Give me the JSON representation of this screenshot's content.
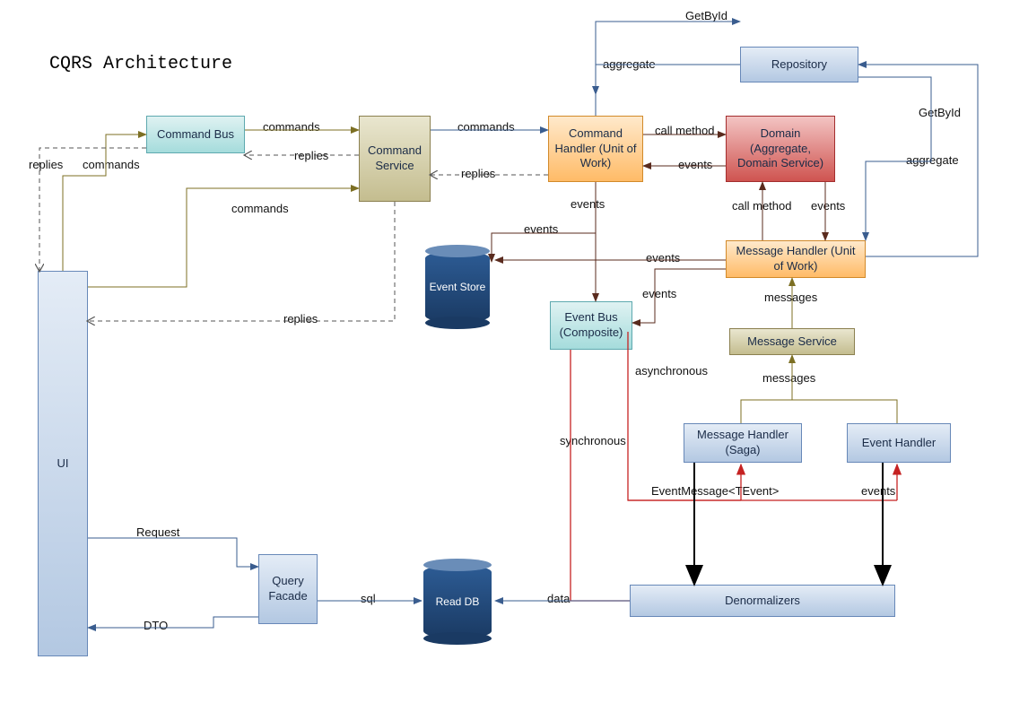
{
  "title": "CQRS Architecture",
  "nodes": {
    "ui": "UI",
    "commandBus": "Command Bus",
    "commandService": "Command\nService",
    "commandHandler": "Command\nHandler\n(Unit of Work)",
    "domain": "Domain\n(Aggregate,\nDomain Service)",
    "repository": "Repository",
    "messageHandlerUoW": "Message Handler\n(Unit of Work)",
    "messageService": "Message Service",
    "eventBus": "Event Bus\n(Composite)",
    "messageHandlerSaga": "Message Handler\n(Saga)",
    "eventHandler": "Event Handler",
    "denormalizers": "Denormalizers",
    "queryFacade": "Query\nFacade",
    "eventStore": "Event\nStore",
    "readDb": "Read DB"
  },
  "edgeLabels": {
    "getById1": "GetById",
    "getById2": "GetById",
    "aggregate1": "aggregate",
    "aggregate2": "aggregate",
    "commands1": "commands",
    "commands2": "commands",
    "commands3": "commands",
    "commands4": "commands",
    "replies1": "replies",
    "replies2": "replies",
    "replies3": "replies",
    "callMethod1": "call method",
    "callMethod2": "call method",
    "events1": "events",
    "events2": "events",
    "events3": "events",
    "events4": "events",
    "events5": "events",
    "events6": "events",
    "events7": "events",
    "messages1": "messages",
    "messages2": "messages",
    "synchronous": "synchronous",
    "asynchronous": "asynchronous",
    "eventMessage": "EventMessage<TEvent>",
    "request": "Request",
    "dto": "DTO",
    "sql": "sql",
    "data": "data"
  }
}
